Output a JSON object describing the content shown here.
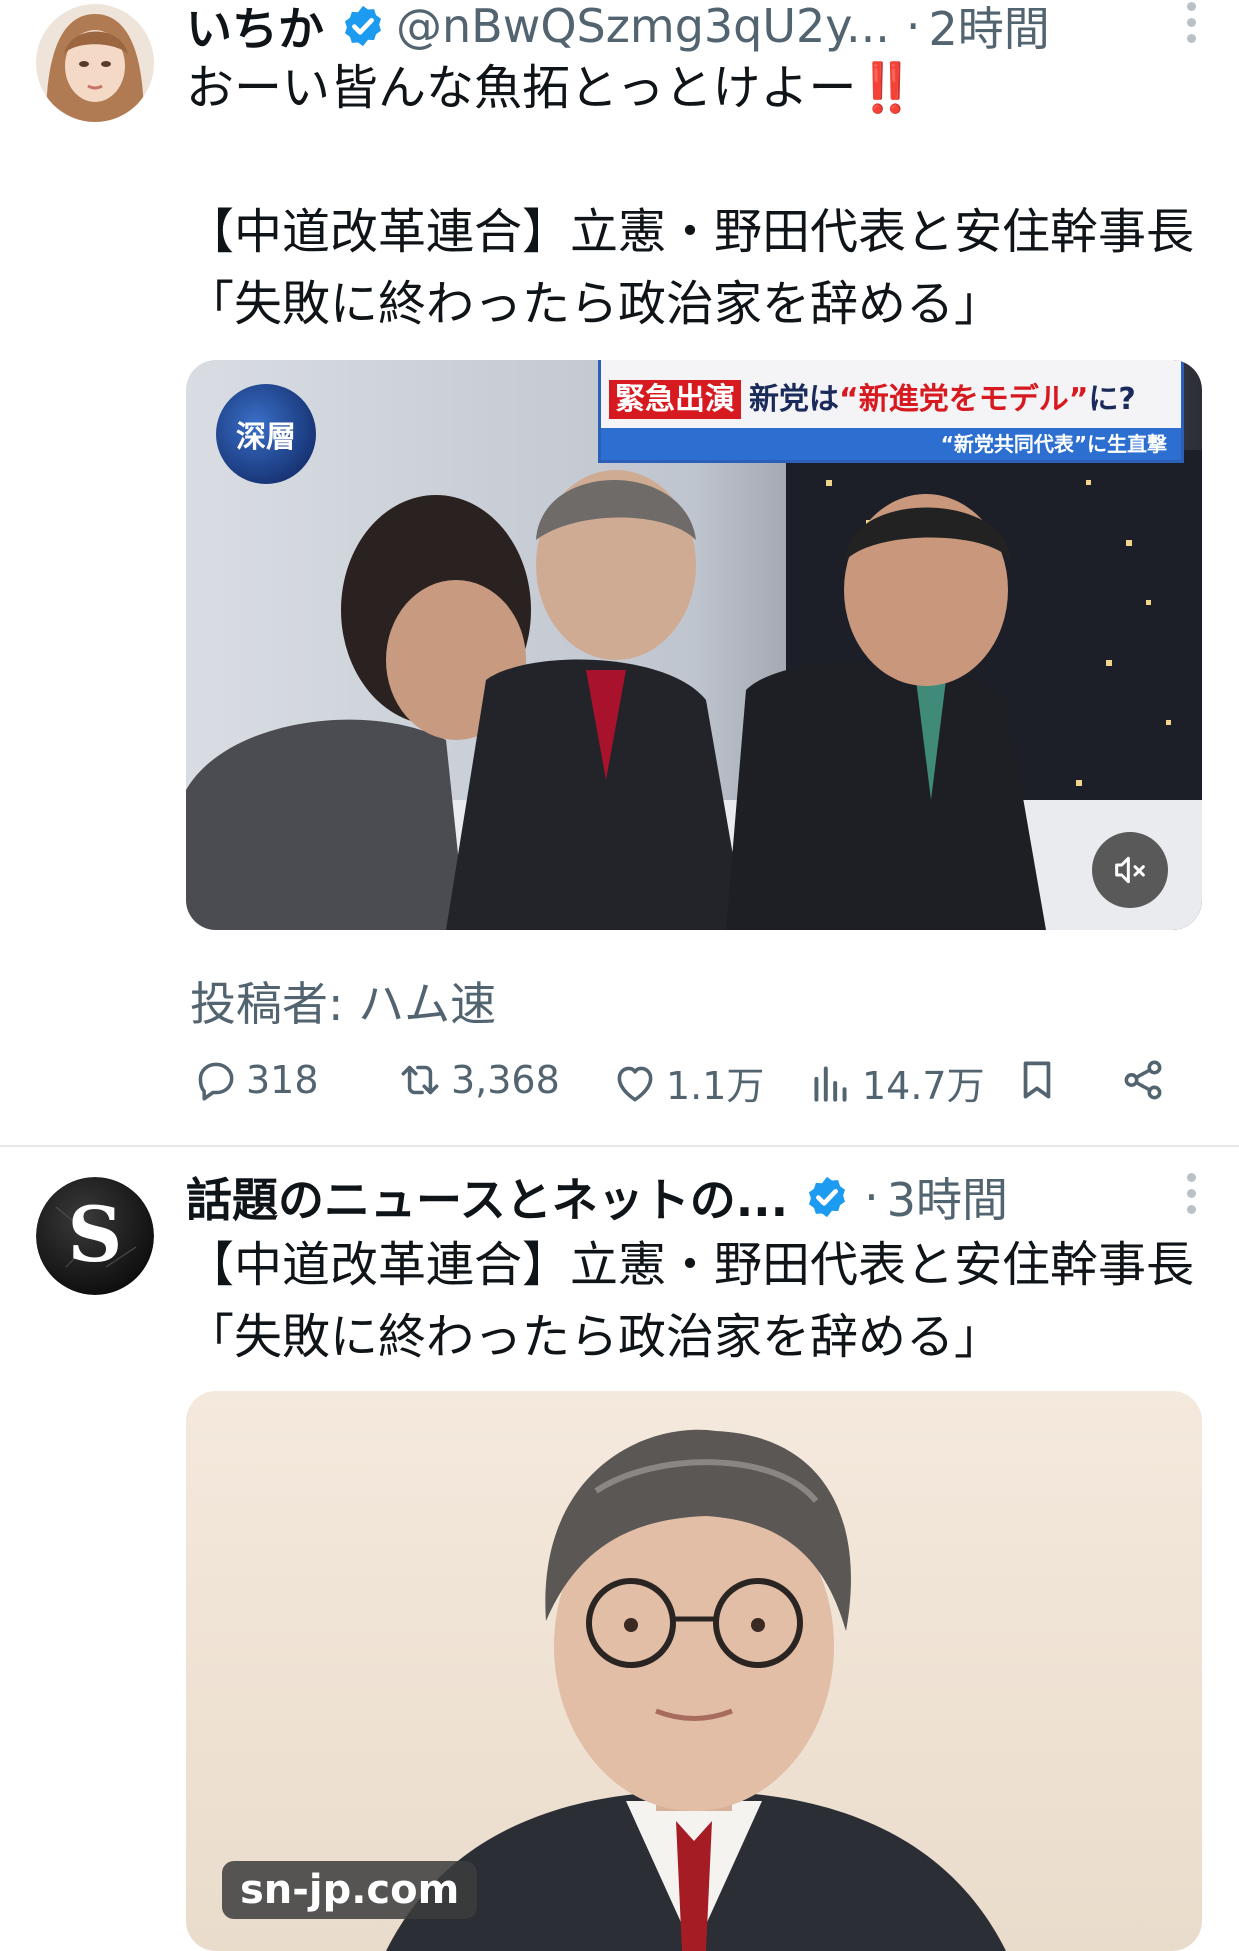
{
  "tweets": [
    {
      "author_name": "いちか",
      "handle": "@nBwQSzmg3qU2y...",
      "separator": "·",
      "time": "2時間",
      "text": "おーい皆んな魚拓とっとけよー‼️\n\n【中道改革連合】立憲・野田代表と安住幹事長「失敗に終わったら政治家を辞める」",
      "media": {
        "tv_logo": "深層",
        "tv_label": "緊急出演",
        "tv_title_a": "新党は",
        "tv_title_b": "“新進党をモデル”",
        "tv_title_c": "に?",
        "tv_sub": "“新党共同代表”に生直撃"
      },
      "credit": "投稿者: ハム速",
      "stats": {
        "replies": "318",
        "reposts": "3,368",
        "likes": "1.1万",
        "views": "14.7万"
      }
    },
    {
      "author_name": "話題のニュースとネットの...",
      "separator": "·",
      "time": "3時間",
      "text": "【中道改革連合】立憲・野田代表と安住幹事長「失敗に終わったら政治家を辞める」",
      "media": {
        "site": "sn-jp.com"
      }
    }
  ],
  "icons": {
    "verified": "verified-badge-icon",
    "reply": "reply-icon",
    "repost": "repost-icon",
    "like": "heart-icon",
    "views": "views-icon",
    "bookmark": "bookmark-icon",
    "share": "share-icon",
    "more": "more-icon",
    "mute": "muted-speaker-icon"
  },
  "colors": {
    "accent": "#1d9bf0",
    "secondary_text": "#536471",
    "divider": "#e4e8eb"
  }
}
